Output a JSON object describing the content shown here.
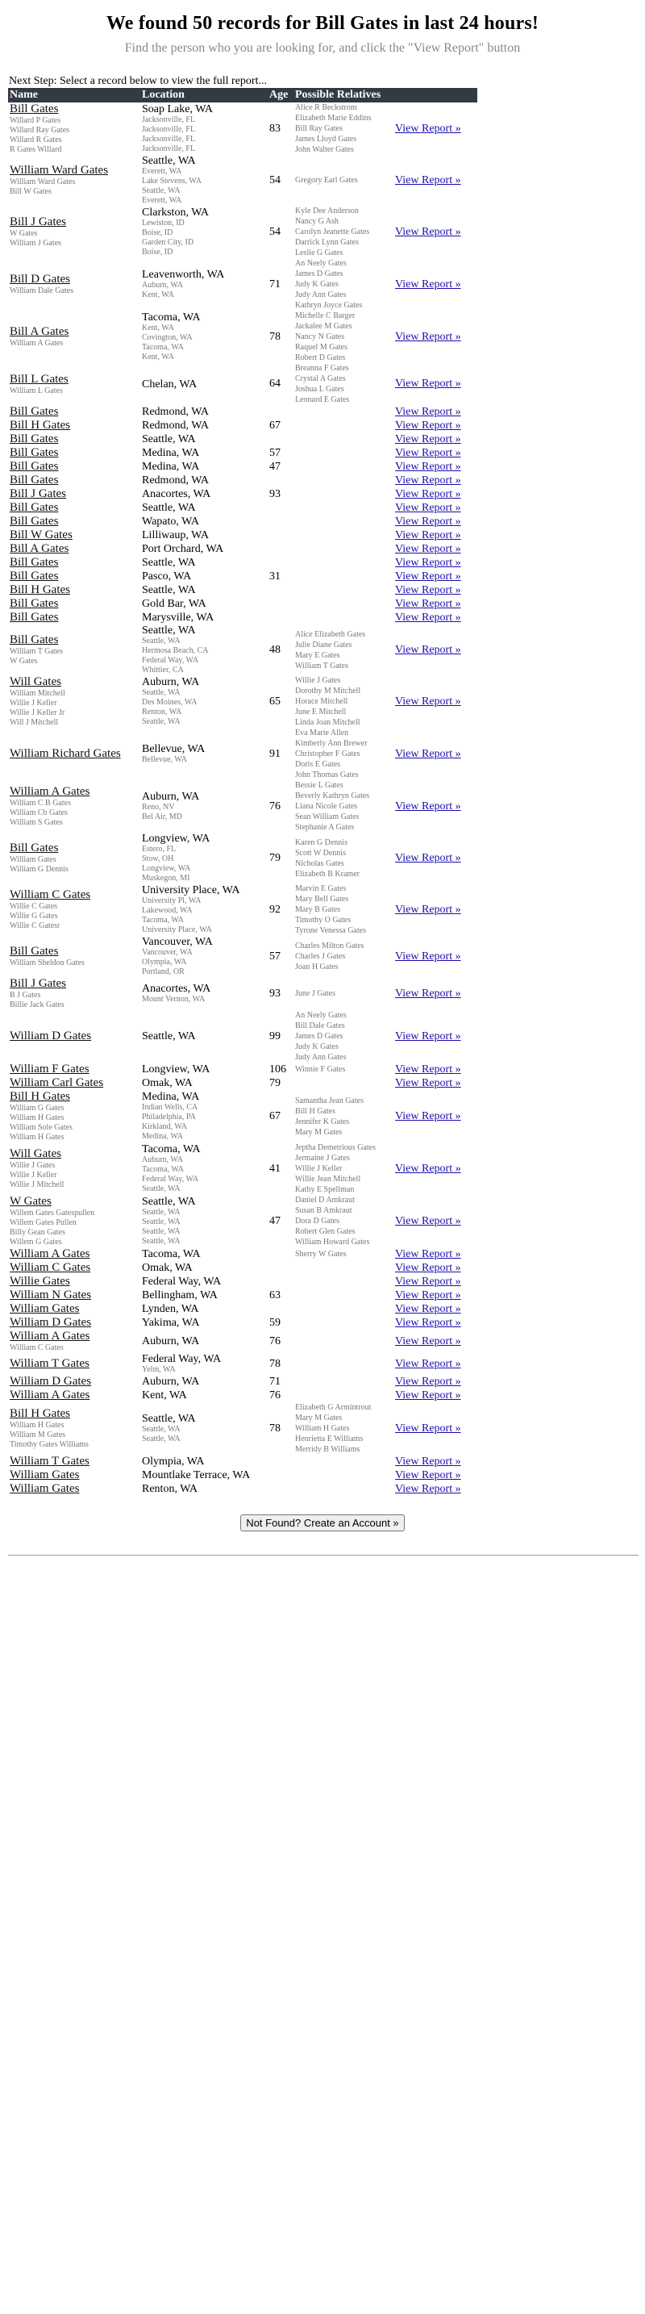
{
  "page": {
    "heading": "We found 50 records for Bill Gates in last 24 hours!",
    "subtitle": "Find the person who you are looking for, and click the \"View Report\" button",
    "next_step": "Next Step: Select a record below to view the full report...",
    "not_found_button": "Not Found? Create an Account »"
  },
  "table": {
    "headers": [
      "Name",
      "Location",
      "Age",
      "Possible Relatives",
      ""
    ],
    "view_report_label": "View Report »",
    "rows": [
      {
        "name": "Bill Gates",
        "aka": [
          "Willard P Gates",
          "Willard Ray Gates",
          "Willard R Gates",
          "R Gates Willard"
        ],
        "location": "Soap Lake, WA",
        "prior": [
          "Jacksonville, FL",
          "Jacksonville, FL",
          "Jacksonville, FL",
          "Jacksonville, FL"
        ],
        "age": "83",
        "relatives": [
          "Alice R Beckstrom",
          "Elizabeth Marie Eddins",
          "Bill Ray Gates",
          "James Lloyd Gates",
          "John Walter Gates"
        ]
      },
      {
        "name": "William Ward Gates",
        "aka": [
          "William Ward Gates",
          "Bill W Gates"
        ],
        "location": "Seattle, WA",
        "prior": [
          "Everett, WA",
          "Lake Stevens, WA",
          "Seattle, WA",
          "Everett, WA"
        ],
        "age": "54",
        "relatives": [
          "Gregory Earl Gates"
        ]
      },
      {
        "name": "Bill J Gates",
        "aka": [
          "W Gates",
          "William J Gates"
        ],
        "location": "Clarkston, WA",
        "prior": [
          "Lewiston, ID",
          "Boise, ID",
          "Garden City, ID",
          "Boise, ID"
        ],
        "age": "54",
        "relatives": [
          "Kyle Dee Anderson",
          "Nancy G Ash",
          "Carolyn Jeanette Gates",
          "Darrick Lynn Gates",
          "Leslie G Gates"
        ]
      },
      {
        "name": "Bill D Gates",
        "aka": [
          "William Dale Gates"
        ],
        "location": "Leavenworth, WA",
        "prior": [
          "Auburn, WA",
          "Kent, WA"
        ],
        "age": "71",
        "relatives": [
          "An Neely Gates",
          "James D Gates",
          "Judy K Gates",
          "Judy Ann Gates",
          "Kathryn Joyce Gates"
        ]
      },
      {
        "name": "Bill A Gates",
        "aka": [
          "William A Gates"
        ],
        "location": "Tacoma, WA",
        "prior": [
          "Kent, WA",
          "Covington, WA",
          "Tacoma, WA",
          "Kent, WA"
        ],
        "age": "78",
        "relatives": [
          "Michelle C Barger",
          "Jackalee M Gates",
          "Nancy N Gates",
          "Raquel M Gates",
          "Robert D Gates"
        ]
      },
      {
        "name": "Bill L Gates",
        "aka": [
          "William L Gates"
        ],
        "location": "Chelan, WA",
        "prior": [],
        "age": "64",
        "relatives": [
          "Breanna F Gates",
          "Crystal A Gates",
          "Joshua L Gates",
          "Leonard E Gates"
        ]
      },
      {
        "name": "Bill Gates",
        "aka": [],
        "location": "Redmond, WA",
        "prior": [],
        "age": "",
        "relatives": []
      },
      {
        "name": "Bill H Gates",
        "aka": [],
        "location": "Redmond, WA",
        "prior": [],
        "age": "67",
        "relatives": []
      },
      {
        "name": "Bill Gates",
        "aka": [],
        "location": "Seattle, WA",
        "prior": [],
        "age": "",
        "relatives": []
      },
      {
        "name": "Bill Gates",
        "aka": [],
        "location": "Medina, WA",
        "prior": [],
        "age": "57",
        "relatives": []
      },
      {
        "name": "Bill Gates",
        "aka": [],
        "location": "Medina, WA",
        "prior": [],
        "age": "47",
        "relatives": []
      },
      {
        "name": "Bill Gates",
        "aka": [],
        "location": "Redmond, WA",
        "prior": [],
        "age": "",
        "relatives": []
      },
      {
        "name": "Bill J Gates",
        "aka": [],
        "location": "Anacortes, WA",
        "prior": [],
        "age": "93",
        "relatives": []
      },
      {
        "name": "Bill Gates",
        "aka": [],
        "location": "Seattle, WA",
        "prior": [],
        "age": "",
        "relatives": []
      },
      {
        "name": "Bill Gates",
        "aka": [],
        "location": "Wapato, WA",
        "prior": [],
        "age": "",
        "relatives": []
      },
      {
        "name": "Bill W Gates",
        "aka": [],
        "location": "Lilliwaup, WA",
        "prior": [],
        "age": "",
        "relatives": []
      },
      {
        "name": "Bill A Gates",
        "aka": [],
        "location": "Port Orchard, WA",
        "prior": [],
        "age": "",
        "relatives": []
      },
      {
        "name": "Bill Gates",
        "aka": [],
        "location": "Seattle, WA",
        "prior": [],
        "age": "",
        "relatives": []
      },
      {
        "name": "Bill Gates",
        "aka": [],
        "location": "Pasco, WA",
        "prior": [],
        "age": "31",
        "relatives": []
      },
      {
        "name": "Bill H Gates",
        "aka": [],
        "location": "Seattle, WA",
        "prior": [],
        "age": "",
        "relatives": []
      },
      {
        "name": "Bill Gates",
        "aka": [],
        "location": "Gold Bar, WA",
        "prior": [],
        "age": "",
        "relatives": []
      },
      {
        "name": "Bill Gates",
        "aka": [],
        "location": "Marysville, WA",
        "prior": [],
        "age": "",
        "relatives": []
      },
      {
        "name": "Bill Gates",
        "aka": [
          "William T Gates",
          "W Gates"
        ],
        "location": "Seattle, WA",
        "prior": [
          "Seattle, WA",
          "Hermosa Beach, CA",
          "Federal Way, WA",
          "Whittier, CA"
        ],
        "age": "48",
        "relatives": [
          "Alice Elizabeth Gates",
          "Julie Diane Gates",
          "Mary E Gates",
          "William T Gates"
        ]
      },
      {
        "name": "Will Gates",
        "aka": [
          "William Mitchell",
          "Willie J Keller",
          "Willie J Keller Jr",
          "Will J Mitchell"
        ],
        "location": "Auburn, WA",
        "prior": [
          "Seattle, WA",
          "Des Moines, WA",
          "Renton, WA",
          "Seattle, WA"
        ],
        "age": "65",
        "relatives": [
          "Willie J Gates",
          "Dorothy M Mitchell",
          "Horace Mitchell",
          "June E Mitchell",
          "Linda Joan Mitchell"
        ]
      },
      {
        "name": "William Richard Gates",
        "aka": [],
        "location": "Bellevue, WA",
        "prior": [
          "Bellevue, WA"
        ],
        "age": "91",
        "relatives": [
          "Eva Marie Allen",
          "Kimberly Ann Brewer",
          "Christopher F Gates",
          "Doris E Gates",
          "John Thomas Gates"
        ]
      },
      {
        "name": "William A Gates",
        "aka": [
          "William C B Gates",
          "William Cb Gates",
          "William S Gates"
        ],
        "location": "Auburn, WA",
        "prior": [
          "Reno, NV",
          "Bel Air, MD"
        ],
        "age": "76",
        "relatives": [
          "Bessie L Gates",
          "Beverly Kathryn Gates",
          "Liana Nicole Gates",
          "Sean William Gates",
          "Stephanie A Gates"
        ]
      },
      {
        "name": "Bill Gates",
        "aka": [
          "William Gates",
          "William G Dennis"
        ],
        "location": "Longview, WA",
        "prior": [
          "Estero, FL",
          "Stow, OH",
          "Longview, WA",
          "Muskegon, MI"
        ],
        "age": "79",
        "relatives": [
          "Karen G Dennis",
          "Scott W Dennis",
          "Nicholas Gates",
          "Elizabeth B Kramer"
        ]
      },
      {
        "name": "William C Gates",
        "aka": [
          "Willie C Gates",
          "Willie G Gates",
          "Willie C Gatesr"
        ],
        "location": "University Place, WA",
        "prior": [
          "University Pl, WA",
          "Lakewood, WA",
          "Tacoma, WA",
          "University Place, WA"
        ],
        "age": "92",
        "relatives": [
          "Marvin E Gates",
          "Mary Bell Gates",
          "Mary B Gates",
          "Timothy O Gates",
          "Tyrone Venessa Gates"
        ]
      },
      {
        "name": "Bill Gates",
        "aka": [
          "William Sheldon Gates"
        ],
        "location": "Vancouver, WA",
        "prior": [
          "Vancouver, WA",
          "Olympia, WA",
          "Portland, OR"
        ],
        "age": "57",
        "relatives": [
          "Charles Milton Gates",
          "Charles J Gates",
          "Joan H Gates"
        ]
      },
      {
        "name": "Bill J Gates",
        "aka": [
          "B J Gates",
          "Billie Jack Gates"
        ],
        "location": "Anacortes, WA",
        "prior": [
          "Mount Vernon, WA"
        ],
        "age": "93",
        "relatives": [
          "June J Gates"
        ]
      },
      {
        "name": "William D Gates",
        "aka": [],
        "location": "Seattle, WA",
        "prior": [],
        "age": "99",
        "relatives": [
          "An Neely Gates",
          "Bill Dale Gates",
          "James D Gates",
          "Judy K Gates",
          "Judy Ann Gates"
        ]
      },
      {
        "name": "William F Gates",
        "aka": [],
        "location": "Longview, WA",
        "prior": [],
        "age": "106",
        "relatives": [
          "Winnie F Gates"
        ]
      },
      {
        "name": "William Carl Gates",
        "aka": [],
        "location": "Omak, WA",
        "prior": [],
        "age": "79",
        "relatives": []
      },
      {
        "name": "Bill H Gates",
        "aka": [
          "William G Gates",
          "William H Gates",
          "William Sole Gates",
          "William H Gates"
        ],
        "location": "Medina, WA",
        "prior": [
          "Indian Wells, CA",
          "Philadelphia, PA",
          "Kirkland, WA",
          "Medina, WA"
        ],
        "age": "67",
        "relatives": [
          "Samantha Jean Gates",
          "Bill H Gates",
          "Jennifer K Gates",
          "Mary M Gates"
        ]
      },
      {
        "name": "Will Gates",
        "aka": [
          "Willie J Gates",
          "Willie J Keller",
          "Willie J Mitchell"
        ],
        "location": "Tacoma, WA",
        "prior": [
          "Auburn, WA",
          "Tacoma, WA",
          "Federal Way, WA",
          "Seattle, WA"
        ],
        "age": "41",
        "relatives": [
          "Jeptha Demetrious Gates",
          "Jermaine J Gates",
          "Willie J Keller",
          "Willie Jean Mitchell",
          "Kathy E Spellman"
        ]
      },
      {
        "name": "W Gates",
        "aka": [
          "Willem Gates Gatespullen",
          "Willem Gates Pullen",
          "Billy Gean Gates",
          "Willem G Gates"
        ],
        "location": "Seattle, WA",
        "prior": [
          "Seattle, WA",
          "Seattle, WA",
          "Seattle, WA",
          "Seattle, WA"
        ],
        "age": "47",
        "relatives": [
          "Daniel D Amkraut",
          "Susan B Amkraut",
          "Dora D Gates",
          "Robert Glen Gates",
          "William Howard Gates"
        ]
      },
      {
        "name": "William A Gates",
        "aka": [],
        "location": "Tacoma, WA",
        "prior": [],
        "age": "",
        "relatives": [
          "Sherry W Gates"
        ]
      },
      {
        "name": "William C Gates",
        "aka": [],
        "location": "Omak, WA",
        "prior": [],
        "age": "",
        "relatives": []
      },
      {
        "name": "Willie Gates",
        "aka": [],
        "location": "Federal Way, WA",
        "prior": [],
        "age": "",
        "relatives": []
      },
      {
        "name": "William N Gates",
        "aka": [],
        "location": "Bellingham, WA",
        "prior": [],
        "age": "63",
        "relatives": []
      },
      {
        "name": "William Gates",
        "aka": [],
        "location": "Lynden, WA",
        "prior": [],
        "age": "",
        "relatives": []
      },
      {
        "name": "William D Gates",
        "aka": [],
        "location": "Yakima, WA",
        "prior": [],
        "age": "59",
        "relatives": []
      },
      {
        "name": "William A Gates",
        "aka": [
          "William C Gates"
        ],
        "location": "Auburn, WA",
        "prior": [],
        "age": "76",
        "relatives": []
      },
      {
        "name": "William T Gates",
        "aka": [],
        "location": "Federal Way, WA",
        "prior": [
          "Yelm, WA"
        ],
        "age": "78",
        "relatives": []
      },
      {
        "name": "William D Gates",
        "aka": [],
        "location": "Auburn, WA",
        "prior": [],
        "age": "71",
        "relatives": []
      },
      {
        "name": "William A Gates",
        "aka": [],
        "location": "Kent, WA",
        "prior": [],
        "age": "76",
        "relatives": []
      },
      {
        "name": "Bill H Gates",
        "aka": [
          "William H Gates",
          "William M Gates",
          "Timothy Gates Williams"
        ],
        "location": "Seattle, WA",
        "prior": [
          "Seattle, WA",
          "Seattle, WA"
        ],
        "age": "78",
        "relatives": [
          "Elizabeth G Armintrout",
          "Mary M Gates",
          "William H Gates",
          "Henrietta E Williams",
          "Merridy B Williams"
        ]
      },
      {
        "name": "William T Gates",
        "aka": [],
        "location": "Olympia, WA",
        "prior": [],
        "age": "",
        "relatives": []
      },
      {
        "name": "William Gates",
        "aka": [],
        "location": "Mountlake Terrace, WA",
        "prior": [],
        "age": "",
        "relatives": []
      },
      {
        "name": "William Gates",
        "aka": [],
        "location": "Renton, WA",
        "prior": [],
        "age": "",
        "relatives": []
      }
    ]
  },
  "colors": {
    "header_bg": "#333a44",
    "link": "#1a0dab",
    "muted": "#777777"
  }
}
